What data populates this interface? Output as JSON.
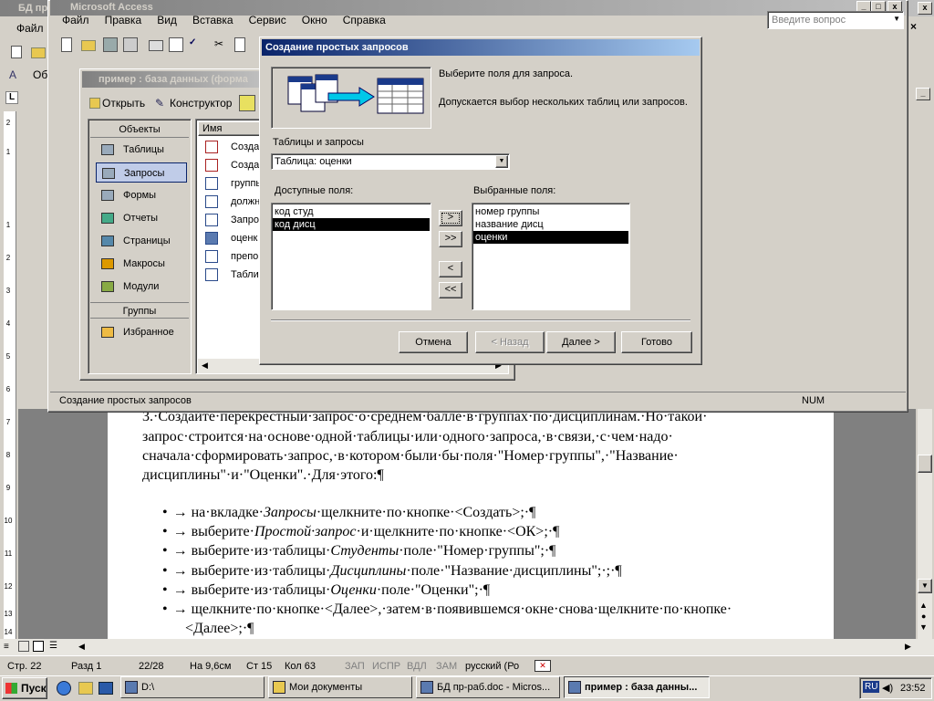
{
  "word": {
    "title": "БД пр",
    "menu_file": "Файл",
    "style_value": "Об",
    "doc": {
      "para_lines": [
        "3.·Создайте·перекрестный·запрос·о·среднем·балле·в·группах·по·дисциплинам.·Но·такой·",
        "запрос·строится·на·основе·одной·таблицы·или·одного·запроса,·в·связи,·с·чем·надо·",
        "сначала·сформировать·запрос,·в·котором·были·бы·поля·\"Номер·группы\",·\"Название·",
        "дисциплины\"·и·\"Оценки\".·Для·этого:¶"
      ],
      "bullets": [
        {
          "pre": "→ на·вкладке·",
          "em": "Запросы",
          "post": "·щелкните·по·кнопке·<Создать>;·¶"
        },
        {
          "pre": "→ выберите·",
          "em": "Простой·запрос",
          "post": "·и·щелкните·по·кнопке·<ОК>;·¶"
        },
        {
          "pre": "→ выберите·из·таблицы·",
          "em": "Студенты",
          "post": "·поле·\"Номер·группы\";·¶"
        },
        {
          "pre": "→ выберите·из·таблицы·",
          "em": "Дисциплины",
          "post": "·поле·\"Название·дисциплины\";·;·¶"
        },
        {
          "pre": "→ выберите·из·таблицы·",
          "em": "Оценки",
          "post": "·поле·\"Оценки\";·¶"
        },
        {
          "pre": "→ щелкните·по·кнопке·<Далее>,·затем·в·появившемся·окне·снова·щелкните·по·кнопке·",
          "em": "",
          "post": ""
        }
      ],
      "bullet_cont": "<Далее>;·¶"
    },
    "ruler_numbers": [
      "2",
      "1",
      "1",
      "2",
      "3",
      "4",
      "5",
      "6",
      "7",
      "8",
      "9",
      "10",
      "11",
      "12",
      "13",
      "14"
    ],
    "statusbar": {
      "page": "Стр. 22",
      "section": "Разд 1",
      "pages": "22/28",
      "at": "На 9,6см",
      "line": "Ст 15",
      "col": "Кол 63",
      "rec": "ЗАП",
      "trk": "ИСПР",
      "ext": "ВДЛ",
      "ovr": "ЗАМ",
      "lang": "русский (Ро"
    }
  },
  "access": {
    "title": "Microsoft Access",
    "menu": [
      "Файл",
      "Правка",
      "Вид",
      "Вставка",
      "Сервис",
      "Окно",
      "Справка"
    ],
    "help_placeholder": "Введите вопрос",
    "status_text": "Создание простых запросов",
    "num": "NUM",
    "db_window": {
      "title": "пример : база данных (форма",
      "toolbar_open": "Открыть",
      "toolbar_design": "Конструктор",
      "objects_header": "Объекты",
      "objects": [
        "Таблицы",
        "Запросы",
        "Формы",
        "Отчеты",
        "Страницы",
        "Макросы",
        "Модули"
      ],
      "groups_header": "Группы",
      "groups": [
        "Избранное"
      ],
      "name_column": "Имя",
      "items": [
        "Созда",
        "Созда",
        "группы",
        "должн",
        "Запро",
        "оценк",
        "препо",
        "Табли"
      ]
    }
  },
  "wizard": {
    "title": "Создание простых запросов",
    "desc1": "Выберите поля для запроса.",
    "desc2": "Допускается выбор нескольких таблиц или запросов.",
    "tables_label": "Таблицы и запросы",
    "tables_value": "Таблица: оценки",
    "available_label": "Доступные поля:",
    "available_fields": [
      "код студ",
      "код дисц"
    ],
    "selected_label": "Выбранные поля:",
    "selected_fields": [
      "номер группы",
      "название дисц",
      "оценки"
    ],
    "btn_add": ">",
    "btn_add_all": ">>",
    "btn_remove": "<",
    "btn_remove_all": "<<",
    "btn_cancel": "Отмена",
    "btn_back": "< Назад",
    "btn_next": "Далее >",
    "btn_finish": "Готово"
  },
  "taskbar": {
    "start": "Пуск",
    "tasks": [
      "D:\\",
      "Мои документы",
      "БД пр-раб.doc - Micros...",
      "пример : база данны..."
    ],
    "lang": "RU",
    "clock": "23:52"
  }
}
